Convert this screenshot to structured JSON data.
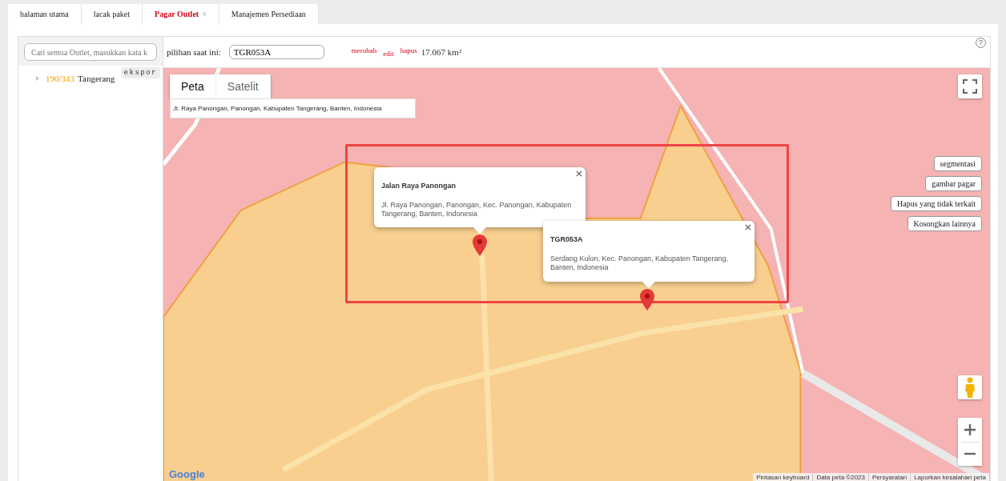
{
  "tabs": [
    {
      "label": "halaman utama",
      "selected": false
    },
    {
      "label": "lacak paket",
      "selected": false
    },
    {
      "label": "Pagar Outlet",
      "selected": true,
      "close": "×"
    },
    {
      "label": "Manajemen Persediaan",
      "selected": false
    }
  ],
  "sidebar": {
    "search": {
      "placeholder": "Cari semua Outlet, masukkan kata k"
    },
    "export_button": "ekspor",
    "tree": [
      {
        "count": "190/343",
        "label": "Tangerang",
        "expanded": false
      }
    ]
  },
  "toolbar": {
    "current_label": "pilihan saat ini:",
    "current_value": "TGR053A",
    "actions": [
      {
        "label": "merubah"
      },
      {
        "label": "edit"
      },
      {
        "label": "hapus"
      }
    ],
    "area": "17.067 km²",
    "help": "?"
  },
  "map": {
    "map_types": [
      {
        "label": "Peta",
        "selected": true
      },
      {
        "label": "Satelit",
        "selected": false
      }
    ],
    "address": "Jl. Raya Panongan, Panongan, Kabupaten Tangerang, Banten, Indonesia",
    "info_windows": [
      {
        "title": "Jalan Raya Panongan",
        "address": "Jl. Raya Panongan, Panongan, Kec. Panongan, Kabupaten Tangerang, Banten, Indonesia"
      },
      {
        "title": "TGR053A",
        "address": "Serdang Kulon, Kec. Panongan, Kabupaten Tangerang, Banten, Indonesia"
      }
    ],
    "buttons": [
      "segmentasi",
      "gambar pagar",
      "Hapus yang tidak terkait",
      "Kosongkan lainnya"
    ],
    "logo": "Google",
    "footer": [
      "Pintasan keyboard",
      "Data peta ©2023",
      "Persyaratan",
      "Laporkan kesalahan peta"
    ]
  }
}
